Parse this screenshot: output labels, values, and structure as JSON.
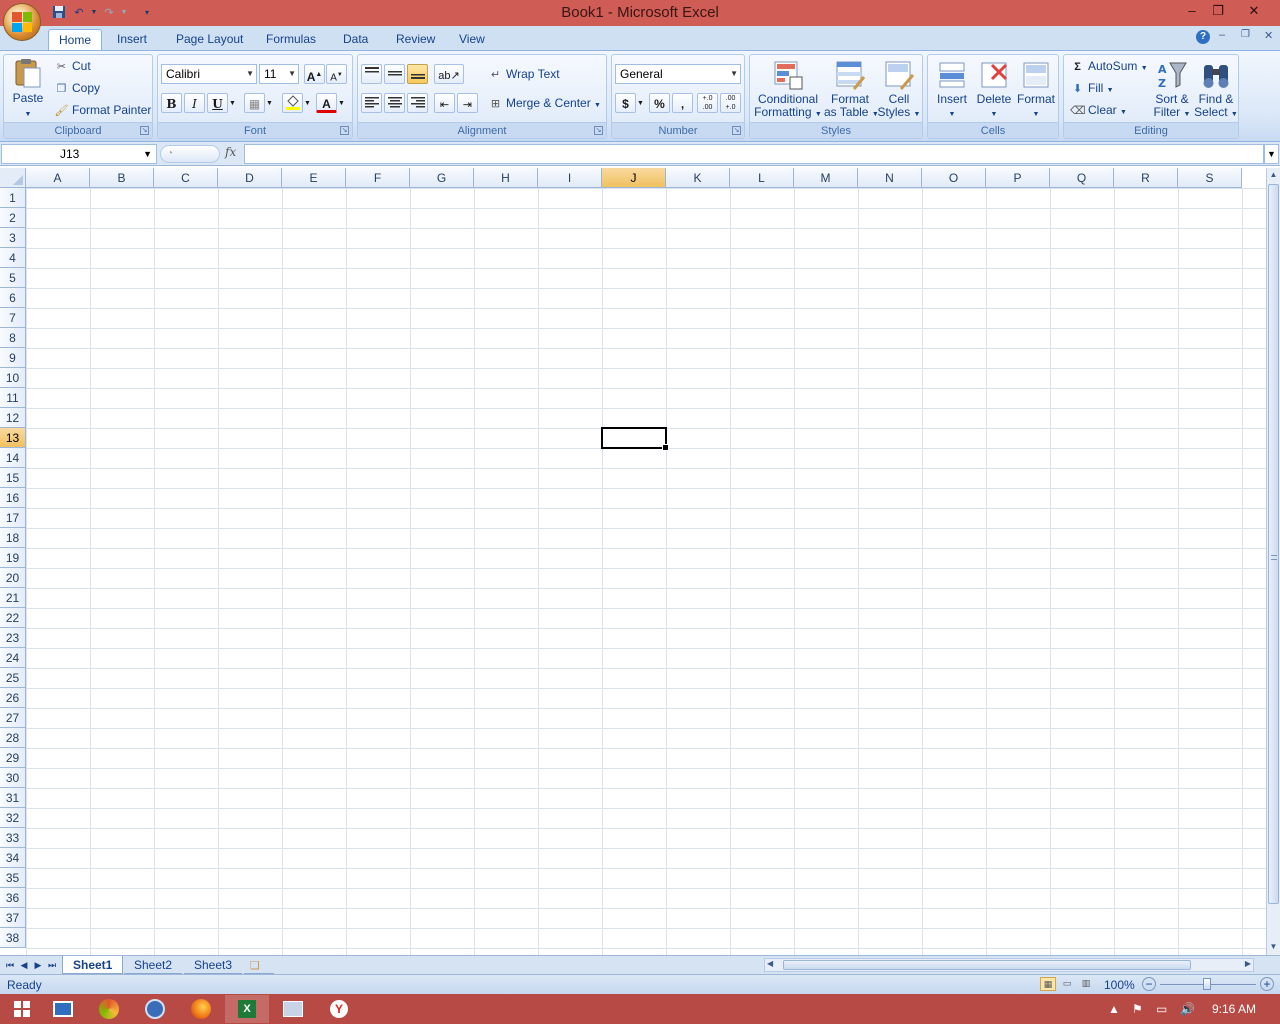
{
  "window": {
    "title": "Book1 - Microsoft Excel",
    "minimize": "–",
    "restore": "❐",
    "close": "✕"
  },
  "qat": {
    "save_icon": "save-icon",
    "undo_icon": "undo-icon",
    "redo_icon": "redo-icon",
    "customize_icon": "customize-qat-icon"
  },
  "tabs": [
    "Home",
    "Insert",
    "Page Layout",
    "Formulas",
    "Data",
    "Review",
    "View"
  ],
  "active_tab": "Home",
  "clipboard": {
    "paste": "Paste",
    "cut": "Cut",
    "copy": "Copy",
    "format_painter": "Format Painter",
    "label": "Clipboard"
  },
  "font": {
    "name": "Calibri",
    "size": "11",
    "bold": "B",
    "italic": "I",
    "underline": "U",
    "label": "Font",
    "grow": "A",
    "shrink": "A",
    "color": "A"
  },
  "alignment": {
    "wrap_text": "Wrap Text",
    "merge_center": "Merge & Center",
    "label": "Alignment"
  },
  "number": {
    "format": "General",
    "currency": "$",
    "percent": "%",
    "comma": ",",
    "inc_decimal": "+.0 .00",
    "dec_decimal": ".00 +.0",
    "label": "Number"
  },
  "styles": {
    "conditional_1": "Conditional",
    "conditional_2": "Formatting",
    "table_1": "Format",
    "table_2": "as Table",
    "cell_1": "Cell",
    "cell_2": "Styles",
    "label": "Styles"
  },
  "cells": {
    "insert": "Insert",
    "delete": "Delete",
    "format": "Format",
    "label": "Cells"
  },
  "editing": {
    "autosum": "AutoSum",
    "fill": "Fill",
    "clear": "Clear",
    "sort_1": "Sort &",
    "sort_2": "Filter",
    "find_1": "Find &",
    "find_2": "Select",
    "label": "Editing",
    "sigma": "Σ"
  },
  "formula_bar": {
    "name_box": "J13",
    "fx": "fx",
    "value": ""
  },
  "columns": [
    "A",
    "B",
    "C",
    "D",
    "E",
    "F",
    "G",
    "H",
    "I",
    "J",
    "K",
    "L",
    "M",
    "N",
    "O",
    "P",
    "Q",
    "R",
    "S"
  ],
  "rows": [
    "1",
    "2",
    "3",
    "4",
    "5",
    "6",
    "7",
    "8",
    "9",
    "10",
    "11",
    "12",
    "13",
    "14",
    "15",
    "16",
    "17",
    "18",
    "19",
    "20",
    "21",
    "22",
    "23",
    "24",
    "25",
    "26",
    "27",
    "28",
    "29",
    "30",
    "31",
    "32",
    "33",
    "34",
    "35",
    "36",
    "37",
    "38"
  ],
  "selected": {
    "col": "J",
    "row": "13"
  },
  "sheets": [
    "Sheet1",
    "Sheet2",
    "Sheet3"
  ],
  "active_sheet": "Sheet1",
  "status": {
    "ready": "Ready",
    "zoom": "100%",
    "zoom_minus": "−",
    "zoom_plus": "+"
  },
  "taskbar": {
    "time": "9:16 AM"
  },
  "colors": {
    "titlebar": "#cf5c55",
    "taskbar": "#b84a46",
    "selected_header": "#f1c15f",
    "ribbon": "#dbe8f8"
  }
}
